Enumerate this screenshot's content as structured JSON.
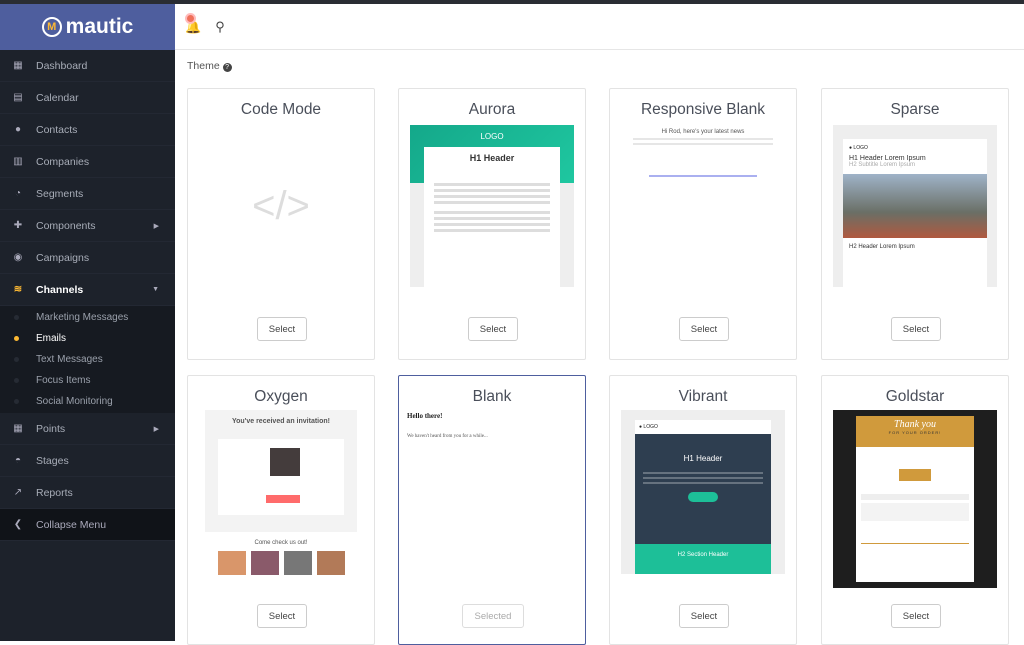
{
  "brand": {
    "name": "mautic",
    "logo_color": "#4e5e9e",
    "accent": "#fdb933"
  },
  "sidebar": {
    "items": [
      {
        "label": "Dashboard",
        "icon": "grid-icon"
      },
      {
        "label": "Calendar",
        "icon": "calendar-icon"
      },
      {
        "label": "Contacts",
        "icon": "user-icon"
      },
      {
        "label": "Companies",
        "icon": "building-icon"
      },
      {
        "label": "Segments",
        "icon": "pie-chart-icon"
      },
      {
        "label": "Components",
        "icon": "puzzle-icon",
        "has_submenu": true
      },
      {
        "label": "Campaigns",
        "icon": "clock-icon"
      },
      {
        "label": "Channels",
        "icon": "rss-icon",
        "expanded": true
      }
    ],
    "channels_sub": [
      "Marketing Messages",
      "Emails",
      "Text Messages",
      "Focus Items",
      "Social Monitoring"
    ],
    "active_sub": "Emails",
    "items_after": [
      {
        "label": "Points",
        "icon": "calculator-icon",
        "has_submenu": true
      },
      {
        "label": "Stages",
        "icon": "gauge-icon"
      },
      {
        "label": "Reports",
        "icon": "line-chart-icon"
      }
    ],
    "collapse": "Collapse Menu"
  },
  "content": {
    "theme_label": "Theme",
    "help": "?",
    "themes": [
      {
        "name": "Code Mode",
        "button": "Select"
      },
      {
        "name": "Aurora",
        "button": "Select",
        "logo": "LOGO",
        "h1": "H1 Header"
      },
      {
        "name": "Responsive Blank",
        "button": "Select",
        "headline": "Hi Rod, here's your latest news"
      },
      {
        "name": "Sparse",
        "button": "Select",
        "logo": "LOGO",
        "h1": "H1 Header Lorem Ipsum",
        "sub": "H2 Subtitle Lorem Ipsum",
        "h2": "H2 Header Lorem Ipsum"
      },
      {
        "name": "Oxygen",
        "button": "Select",
        "headline": "You've received an invitation!",
        "sub": "Come check us out!"
      },
      {
        "name": "Blank",
        "button": "Selected",
        "selected": true,
        "h1": "Hello there!",
        "text": "We haven't heard from you for a while..."
      },
      {
        "name": "Vibrant",
        "button": "Select",
        "logo": "LOGO",
        "h1": "H1 Header",
        "h2": "H2 Section Header"
      },
      {
        "name": "Goldstar",
        "button": "Select",
        "h1": "Thank you",
        "sub": "FOR YOUR ORDER!"
      }
    ]
  }
}
